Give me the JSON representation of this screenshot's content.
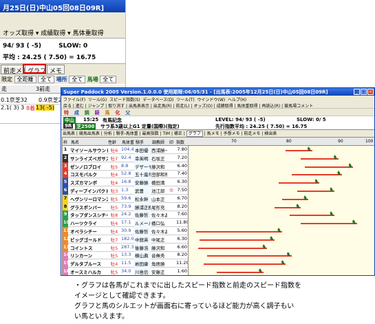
{
  "crop": {
    "title": "月25日(日)中山05回08日09R]",
    "toolbar_items": [
      "オッズ取得",
      "成績取得",
      "馬体重取得"
    ],
    "level_line": "94/ 93 ( -5)",
    "slow_label": "SLOW:",
    "slow_value": "0",
    "avg_line": "平均 : 24.25  ( 7.50) = 16.75",
    "tabs": [
      "前走メモ",
      "グラフ",
      "メモ"
    ],
    "filter_label": "限定",
    "filter_value": "全距離",
    "filter_select": "全て",
    "place_label": "場所",
    "place_value": "全て",
    "baba_label": "馬場",
    "baba_value": "全て",
    "col_prev": "走",
    "col_3prev": "3前走",
    "row1_a": "0.1京芝32",
    "row1_b": "0.9京芝2",
    "row2_a": "2.1( 3) 3",
    "row2_b": "8着",
    "row2_c": "13( -5)"
  },
  "window": {
    "title": "Super Paddock 2005 Version.1.0.0.0  使用期限:06/05/31 - [出馬表:2005年12月25日(日)中山05回08日09R]",
    "menu": [
      "ファイル(F)",
      "ツール(G)",
      "スピード指数(S)",
      "データベース(D)",
      "ツール(T)",
      "ウインドウ(W)",
      "ヘルプ(H)"
    ],
    "toolbar": [
      "戻る",
      "進む",
      "ジャンプ",
      "取り消す",
      "出馬表表示",
      "出走馬(R)",
      "前走(L)",
      "オッズ(O)",
      "成績取得",
      "馬体重取得",
      "再読込(R)",
      "競馬場コメント"
    ],
    "kanji_buttons": [
      "特",
      "成",
      "調",
      "騎",
      "馬",
      "化",
      "父"
    ],
    "venue": "中山",
    "time": "15:25",
    "race_name": "有馬記念",
    "race_no": "9R",
    "distance": "芝2500",
    "race_class": "サラ系3歳以上G1 定量(国際)(指定)",
    "level": "LEVEL: 94/ 93 ( -5)",
    "slow": "SLOW:  0/  5",
    "pace": "先行指数平均 : 24.25  ( 7.50) = 16.75",
    "tabs": [
      "出馬表",
      "競馬出馬表",
      "分析",
      "騎手-馬体重",
      "最高指数",
      "TIM",
      "補正",
      "グラフ",
      "馬メモ",
      "予想メモ",
      "前走メモ",
      "検出表"
    ],
    "headers": [
      "枠",
      "馬名",
      "性齢",
      "馬体重",
      "騎手",
      "調教師",
      "印",
      "前走",
      "指数"
    ],
    "axis_labels": [
      "70",
      "80",
      "90",
      "100"
    ]
  },
  "horses": [
    {
      "waku": "1",
      "name": "マイソールサウンド",
      "sex": "牡6",
      "odds": "104.4",
      "jockey": "本田優",
      "trainer": "西浦勝一",
      "mark": "",
      "speed": "7.80",
      "cur": 0.52,
      "prev": 0.66,
      "color": "#ffffff",
      "fg": "#000"
    },
    {
      "waku": "2",
      "name": "サンライズペガサス",
      "sex": "牡7",
      "odds": "92.4",
      "jockey": "幸英明",
      "trainer": "石坂正",
      "mark": "",
      "speed": "7.20",
      "cur": 0.6,
      "prev": 0.8,
      "color": "#333333",
      "fg": "#fff"
    },
    {
      "waku": "3",
      "name": "ゼンノロブロイ",
      "sex": "牡5",
      "odds": "8.8",
      "jockey": "デザーモ",
      "trainer": "藤沢和",
      "mark": "",
      "speed": "6.40",
      "cur": 0.62,
      "prev": 0.88,
      "color": "#e53b2a",
      "fg": "#fff"
    },
    {
      "waku": "4",
      "name": "コスモバルク",
      "sex": "牡4",
      "odds": "52.8",
      "jockey": "五十嵐冬",
      "trainer": "田部和則",
      "mark": "",
      "speed": "7.40",
      "cur": 0.55,
      "prev": 0.82,
      "color": "#e53b2a",
      "fg": "#fff"
    },
    {
      "waku": "5",
      "name": "スズカマンボ",
      "sex": "牡4",
      "odds": "16.8",
      "jockey": "安藤勝",
      "trainer": "橋田満",
      "mark": "",
      "speed": "6.30",
      "cur": 0.48,
      "prev": 0.7,
      "color": "#2a4fb0",
      "fg": "#fff"
    },
    {
      "waku": "6",
      "name": "ディープインパクト",
      "sex": "牡3",
      "odds": "1.3",
      "jockey": "武豊",
      "trainer": "池江郎",
      "mark": "◎",
      "speed": "7.50",
      "cur": 0.58,
      "prev": 0.78,
      "color": "#2a4fb0",
      "fg": "#fff"
    },
    {
      "waku": "7",
      "name": "ヘヴンリーロマンス",
      "sex": "牝5",
      "odds": "59.6",
      "jockey": "松永幹",
      "trainer": "山本正",
      "mark": "",
      "speed": "6.70",
      "cur": 0.5,
      "prev": 0.64,
      "color": "#f6d61f",
      "fg": "#000"
    },
    {
      "waku": "8",
      "name": "グラスボンバー",
      "sex": "牡5",
      "odds": "73.9",
      "jockey": "勝浦正樹",
      "trainer": "尾形充",
      "mark": "",
      "speed": "8.20",
      "cur": 0.46,
      "prev": 0.6,
      "color": "#f6d61f",
      "fg": "#000"
    },
    {
      "waku": "9",
      "name": "タップダンスシチー",
      "sex": "牡8",
      "odds": "24.2",
      "jockey": "佐藤哲",
      "trainer": "佐々木晶",
      "mark": "",
      "speed": "7.60",
      "cur": 0.54,
      "prev": 0.78,
      "color": "#27a34a",
      "fg": "#fff"
    },
    {
      "waku": "10",
      "name": "ハーツクライ",
      "sex": "牡4",
      "odds": "17.1",
      "jockey": "ルメール",
      "trainer": "橋口弘",
      "mark": "",
      "speed": "11.80",
      "cur": 0.6,
      "prev": 0.9,
      "color": "#27a34a",
      "fg": "#fff"
    },
    {
      "waku": "11",
      "name": "オペラシチー",
      "sex": "牡4",
      "odds": "30.9",
      "jockey": "佐藤哲",
      "trainer": "佐々木晶",
      "mark": "",
      "speed": "5.60",
      "cur": 0.04,
      "prev": 0.5,
      "color": "#f08a24",
      "fg": "#fff"
    },
    {
      "waku": "12",
      "name": "ビッグゴールド",
      "sex": "牡7",
      "odds": "182.0",
      "jockey": "中舘英",
      "trainer": "中尾正",
      "mark": "",
      "speed": "6.30",
      "cur": 0.06,
      "prev": 0.46,
      "color": "#f08a24",
      "fg": "#fff"
    },
    {
      "waku": "13",
      "name": "コイントス",
      "sex": "牡5",
      "odds": "287.3",
      "jockey": "後藤浩",
      "trainer": "藤沢和",
      "mark": "",
      "speed": "6.60",
      "cur": 0.05,
      "prev": 0.42,
      "color": "#f08a24",
      "fg": "#fff"
    },
    {
      "waku": "14",
      "name": "リンカーン",
      "sex": "牡5",
      "odds": "13.3",
      "jockey": "横山典",
      "trainer": "音無秀",
      "mark": "",
      "speed": "8.20",
      "cur": 0.1,
      "prev": 0.55,
      "color": "#e07db8",
      "fg": "#fff"
    },
    {
      "waku": "15",
      "name": "デルタブルース",
      "sex": "牡4",
      "odds": "11.5",
      "jockey": "岩田康",
      "trainer": "角居勝",
      "mark": "",
      "speed": "11.20",
      "cur": 0.08,
      "prev": 0.52,
      "color": "#e07db8",
      "fg": "#fff"
    },
    {
      "waku": "16",
      "name": "オースミハルカ",
      "sex": "牝5",
      "odds": "34.0",
      "jockey": "川島信",
      "trainer": "安藤正",
      "mark": "",
      "speed": "1.60",
      "cur": 0.15,
      "prev": 0.4,
      "color": "#e07db8",
      "fg": "#fff"
    }
  ],
  "notes": [
    "・グラフは各馬がこれまでに出したスピード指数と前走のスピード指数を",
    "  イメージとして確認できます。",
    "  グラフと馬のシルエットが画面右に寄っているほど能力が高く調子もい",
    "  い馬といえます。"
  ]
}
